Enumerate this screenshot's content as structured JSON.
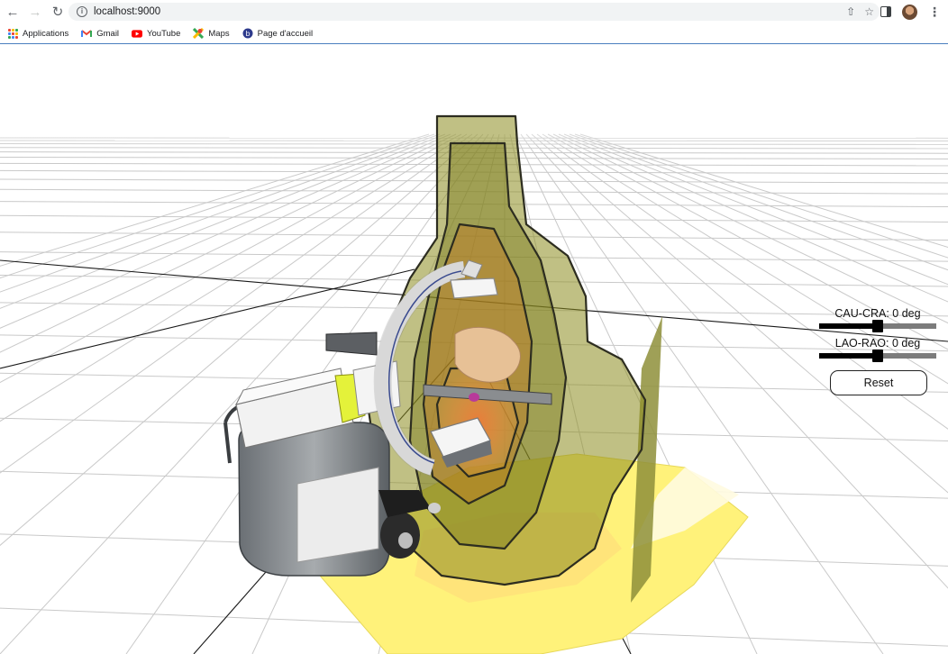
{
  "browser": {
    "url": "localhost:9000",
    "bookmarks": [
      {
        "label": "Applications",
        "icon": "apps-grid-icon"
      },
      {
        "label": "Gmail",
        "icon": "gmail-icon"
      },
      {
        "label": "YouTube",
        "icon": "youtube-icon"
      },
      {
        "label": "Maps",
        "icon": "maps-icon"
      },
      {
        "label": "Page d'accueil",
        "icon": "home-page-icon"
      }
    ]
  },
  "controls": {
    "cau_cra": {
      "label": "CAU-CRA: 0 deg",
      "value_fraction": 0.5
    },
    "lao_rao": {
      "label": "LAO-RAO: 0 deg",
      "value_fraction": 0.5
    },
    "reset_label": "Reset"
  },
  "colors": {
    "dose_isodose": "#8a8a1e",
    "floor_dose": "#fff27a",
    "c_arm": "#f2f2f2",
    "accent_ring": "#e4f23a"
  }
}
